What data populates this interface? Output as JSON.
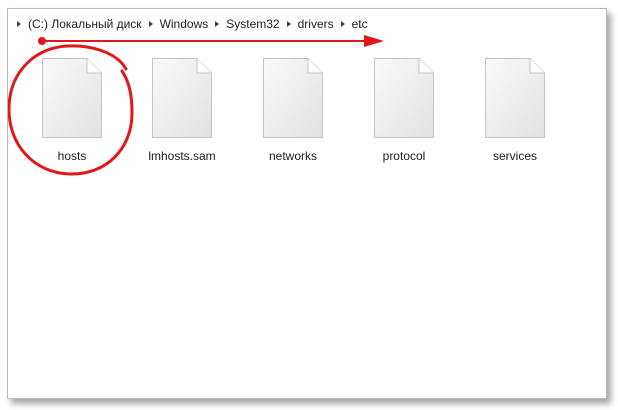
{
  "breadcrumb": {
    "segments": [
      "(C:) Локальный диск",
      "Windows",
      "System32",
      "drivers",
      "etc"
    ]
  },
  "files": [
    {
      "name": "hosts",
      "icon": "document-icon",
      "highlighted": true
    },
    {
      "name": "lmhosts.sam",
      "icon": "document-icon"
    },
    {
      "name": "networks",
      "icon": "document-icon"
    },
    {
      "name": "protocol",
      "icon": "document-icon"
    },
    {
      "name": "services",
      "icon": "document-icon"
    }
  ],
  "colors": {
    "annotation": "#e01818",
    "window_border": "#b9b9b9",
    "text": "#1e1e1e"
  }
}
